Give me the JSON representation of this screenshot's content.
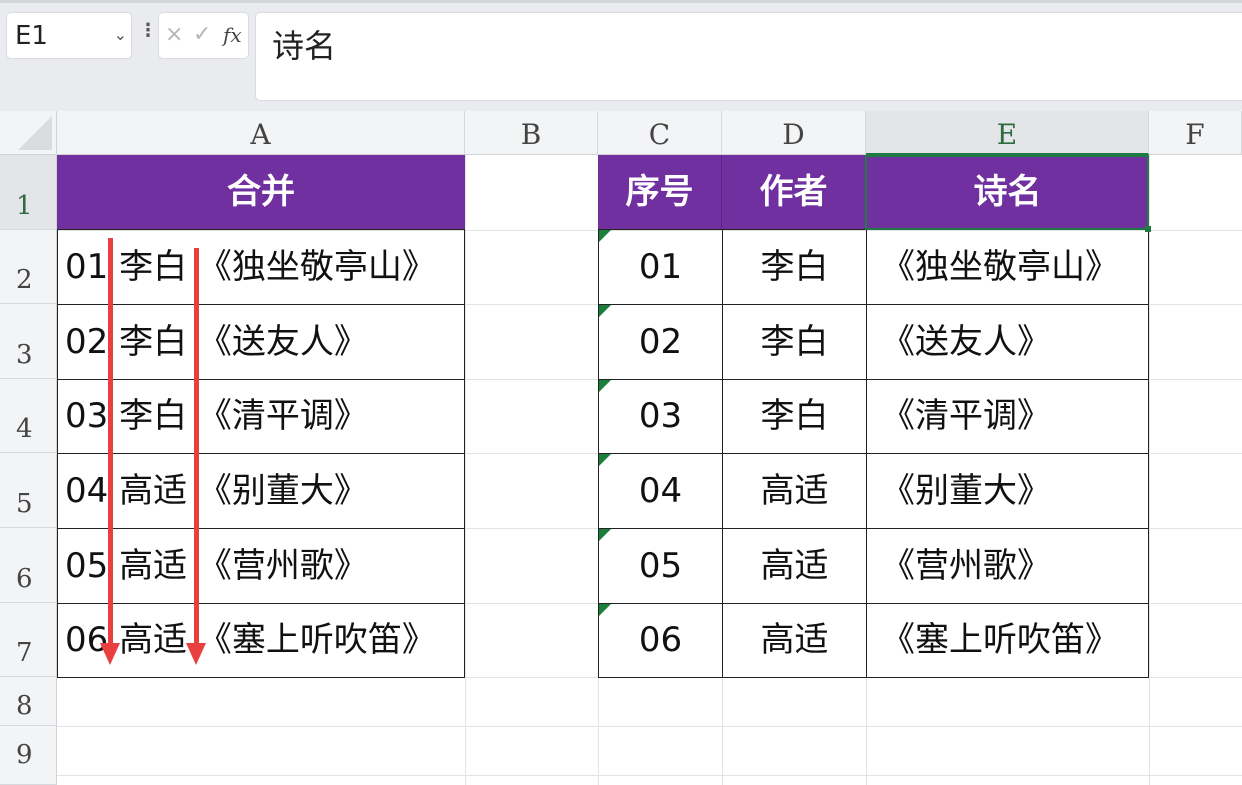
{
  "formula_bar": {
    "name_box": "E1",
    "more_icon": "more-vertical-icon",
    "cancel_icon": "×",
    "enter_icon": "✓",
    "fx_label": "fx",
    "formula": "诗名"
  },
  "columns": [
    "A",
    "B",
    "C",
    "D",
    "E",
    "F"
  ],
  "selected_column": "E",
  "rows": [
    "1",
    "2",
    "3",
    "4",
    "5",
    "6",
    "7",
    "8",
    "9"
  ],
  "selected_row": "1",
  "merged_table": {
    "header": "合并",
    "rows": [
      "01 李白 《独坐敬亭山》",
      "02 李白 《送友人》",
      "03 李白 《清平调》",
      "04 高适 《别董大》",
      "05 高适 《营州歌》",
      "06 高适 《塞上听吹笛》"
    ]
  },
  "source_table": {
    "headers": [
      "序号",
      "作者",
      "诗名"
    ],
    "rows": [
      [
        "01",
        "李白",
        "《独坐敬亭山》"
      ],
      [
        "02",
        "李白",
        "《送友人》"
      ],
      [
        "03",
        "李白",
        "《清平调》"
      ],
      [
        "04",
        "高适",
        "《别董大》"
      ],
      [
        "05",
        "高适",
        "《营州歌》"
      ],
      [
        "06",
        "高适",
        "《塞上听吹笛》"
      ]
    ]
  },
  "colors": {
    "header_fill": "#7030a0",
    "header_text": "#ffffff",
    "selection": "#1f7a44",
    "arrow": "#e8403e"
  }
}
